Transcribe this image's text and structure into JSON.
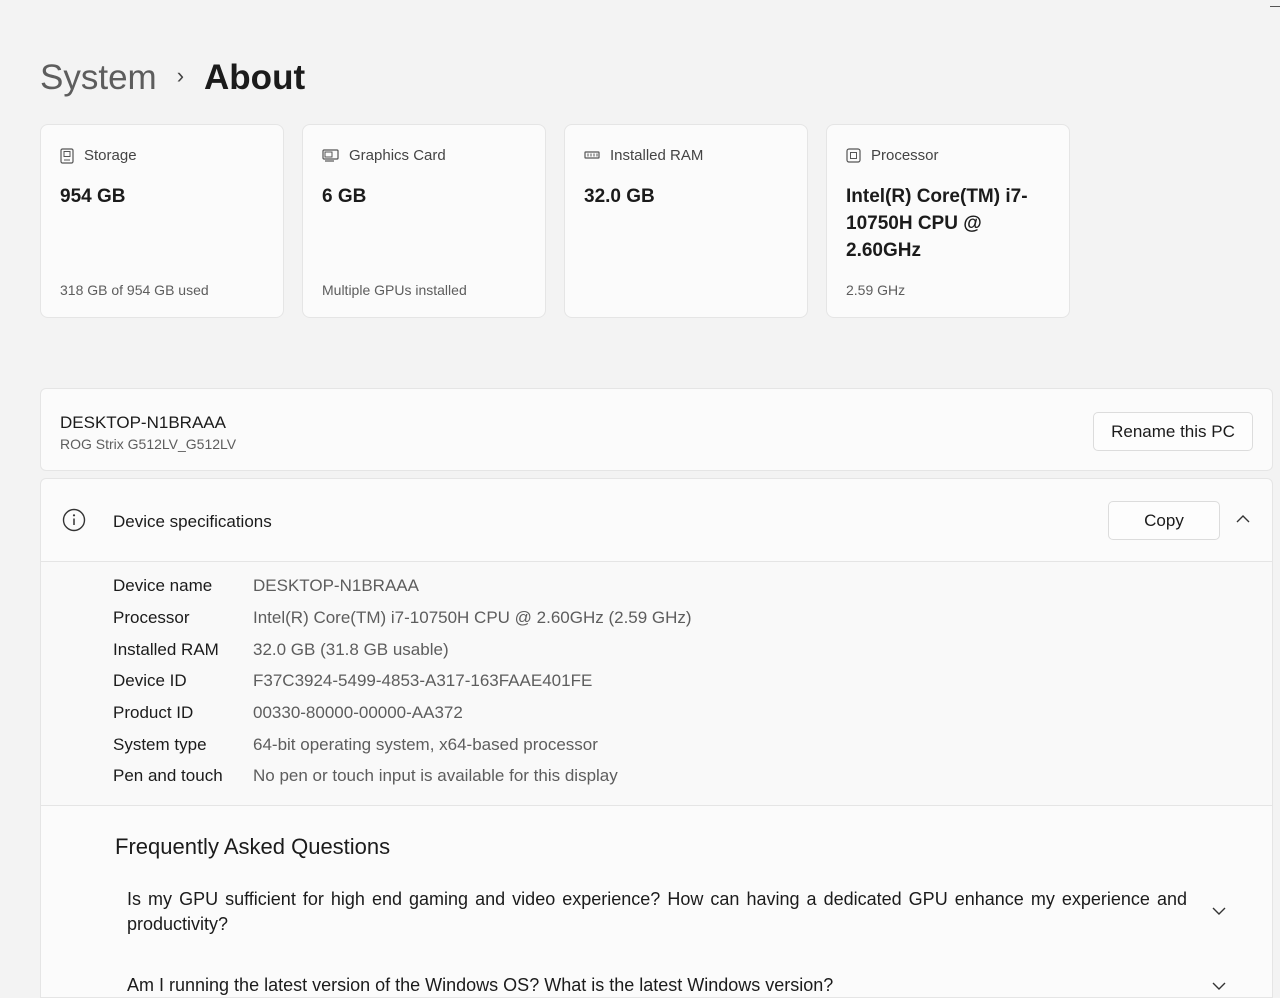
{
  "breadcrumb": {
    "parent": "System",
    "separator": "›",
    "current": "About"
  },
  "cards": [
    {
      "icon": "storage-icon",
      "title": "Storage",
      "value": "954 GB",
      "sub": "318 GB of 954 GB used"
    },
    {
      "icon": "graphics-card-icon",
      "title": "Graphics Card",
      "value": "6 GB",
      "sub": "Multiple GPUs installed"
    },
    {
      "icon": "ram-icon",
      "title": "Installed RAM",
      "value": "32.0 GB",
      "sub": ""
    },
    {
      "icon": "processor-icon",
      "title": "Processor",
      "value": "Intel(R) Core(TM) i7-10750H CPU @ 2.60GHz",
      "sub": "2.59 GHz"
    }
  ],
  "pc": {
    "name": "DESKTOP-N1BRAAA",
    "model": "ROG Strix G512LV_G512LV",
    "rename_label": "Rename this PC"
  },
  "specs": {
    "title": "Device specifications",
    "copy_label": "Copy",
    "rows": [
      {
        "label": "Device name",
        "value": "DESKTOP-N1BRAAA"
      },
      {
        "label": "Processor",
        "value": "Intel(R) Core(TM) i7-10750H CPU @ 2.60GHz (2.59 GHz)"
      },
      {
        "label": "Installed RAM",
        "value": "32.0 GB (31.8 GB usable)"
      },
      {
        "label": "Device ID",
        "value": "F37C3924-5499-4853-A317-163FAAE401FE"
      },
      {
        "label": "Product ID",
        "value": "00330-80000-00000-AA372"
      },
      {
        "label": "System type",
        "value": "64-bit operating system, x64-based processor"
      },
      {
        "label": "Pen and touch",
        "value": "No pen or touch input is available for this display"
      }
    ]
  },
  "faq": {
    "title": "Frequently Asked Questions",
    "items": [
      "Is my GPU sufficient for high end gaming and video experience? How can having a dedicated GPU enhance my experience and productivity?",
      "Am I running the latest version of the Windows OS? What is the latest Windows version?"
    ]
  }
}
